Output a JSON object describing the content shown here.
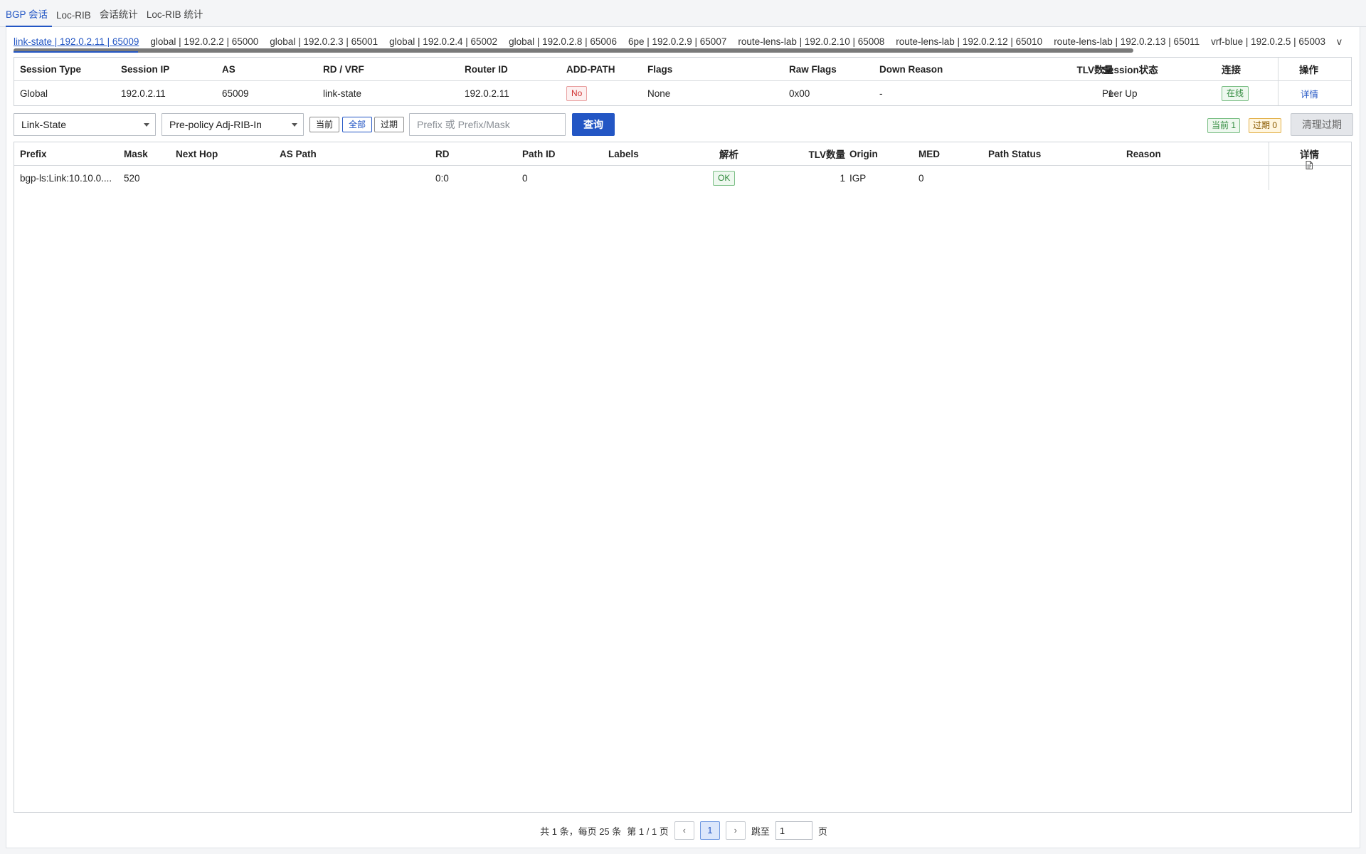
{
  "top_tabs": [
    {
      "label": "BGP 会话",
      "active": true
    },
    {
      "label": "Loc-RIB",
      "active": false
    },
    {
      "label": "会话统计",
      "active": false
    },
    {
      "label": "Loc-RIB 统计",
      "active": false
    }
  ],
  "sessions": [
    "link-state | 192.0.2.11 | 65009",
    "global | 192.0.2.2 | 65000",
    "global | 192.0.2.3 | 65001",
    "global | 192.0.2.4 | 65002",
    "global | 192.0.2.8 | 65006",
    "6pe | 192.0.2.9 | 65007",
    "route-lens-lab | 192.0.2.10 | 65008",
    "route-lens-lab | 192.0.2.12 | 65010",
    "route-lens-lab | 192.0.2.13 | 65011",
    "vrf-blue | 192.0.2.5 | 65003",
    "v"
  ],
  "session_table": {
    "headers": [
      "Session Type",
      "Session IP",
      "AS",
      "RD / VRF",
      "Router ID",
      "ADD-PATH",
      "Flags",
      "Raw Flags",
      "Down Reason",
      "TLV数量",
      "Session状态",
      "连接",
      "操作"
    ],
    "row": {
      "session_type": "Global",
      "session_ip": "192.0.2.11",
      "as": "65009",
      "rd_vrf": "link-state",
      "router_id": "192.0.2.11",
      "add_path": "No",
      "flags": "None",
      "raw_flags": "0x00",
      "down_reason": "-",
      "tlv_count": "1",
      "session_state": "Peer Up",
      "connection": "在线",
      "action": "详情"
    }
  },
  "toolbar": {
    "afi_select": "Link-State",
    "policy_select": "Pre-policy Adj-RIB-In",
    "seg_current": "当前",
    "seg_all": "全部",
    "seg_expired": "过期",
    "search_placeholder": "Prefix 或 Prefix/Mask",
    "query_label": "查询",
    "current_badge": "当前 1",
    "expired_badge": "过期 0",
    "clear_label": "清理过期"
  },
  "route_table": {
    "headers": [
      "Prefix",
      "Mask",
      "Next Hop",
      "AS Path",
      "RD",
      "Path ID",
      "Labels",
      "解析",
      "TLV数量",
      "Origin",
      "MED",
      "Path Status",
      "Reason",
      "详情"
    ],
    "rows": [
      {
        "prefix": "bgp-ls:Link:10.10.0....",
        "mask": "520",
        "next_hop": "",
        "as_path": "",
        "rd": "0:0",
        "path_id": "0",
        "labels": "",
        "parse": "OK",
        "tlv_count": "1",
        "origin": "IGP",
        "med": "0",
        "path_status": "",
        "reason": ""
      }
    ]
  },
  "pager": {
    "summary": "共 1 条，每页 25 条",
    "page_info": "第 1 / 1 页",
    "prev": "‹",
    "current_page": "1",
    "next": "›",
    "jump_label": "跳至",
    "jump_value": "1",
    "page_suffix": "页"
  },
  "colors": {
    "accent": "#2356c4",
    "ok_green": "#2f8a3c",
    "error_red": "#d03030",
    "warn_yellow": "#e3b24d"
  }
}
